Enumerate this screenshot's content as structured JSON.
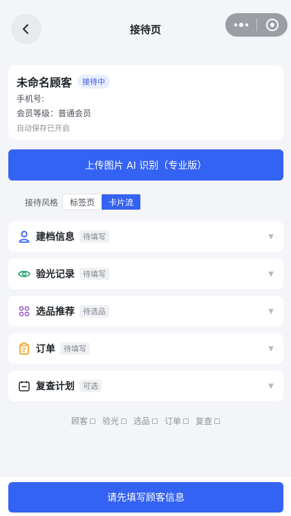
{
  "nav": {
    "title": "接待页"
  },
  "customer": {
    "name": "未命名顾客",
    "status": "接待中",
    "phone_label": "手机号:",
    "level_line": "会员等级：普通会员",
    "autosave": "自动保存已开启"
  },
  "upload": {
    "label": "上传图片 AI 识别（专业版）"
  },
  "style": {
    "label": "接待风格",
    "options": [
      "标签页",
      "卡片流"
    ],
    "selected": "卡片流"
  },
  "sections": [
    {
      "title": "建档信息",
      "tag": "待填写",
      "icon": "user-icon",
      "color": "#3462f2"
    },
    {
      "title": "验光记录",
      "tag": "待填写",
      "icon": "eye-icon",
      "color": "#22a06b"
    },
    {
      "title": "选品推荐",
      "tag": "待选品",
      "icon": "grid-icon",
      "color": "#9b59d0"
    },
    {
      "title": "订单",
      "tag": "待填写",
      "icon": "clipboard-icon",
      "color": "#f0a020"
    },
    {
      "title": "复查计划",
      "tag": "可选",
      "icon": "calendar-icon",
      "color": "#2b2f36"
    }
  ],
  "progress": [
    "顾客",
    "验光",
    "选品",
    "订单",
    "复查"
  ],
  "submit": {
    "label": "请先填写顾客信息"
  },
  "colors": {
    "primary": "#3462f2",
    "background": "#f4f5f8"
  }
}
